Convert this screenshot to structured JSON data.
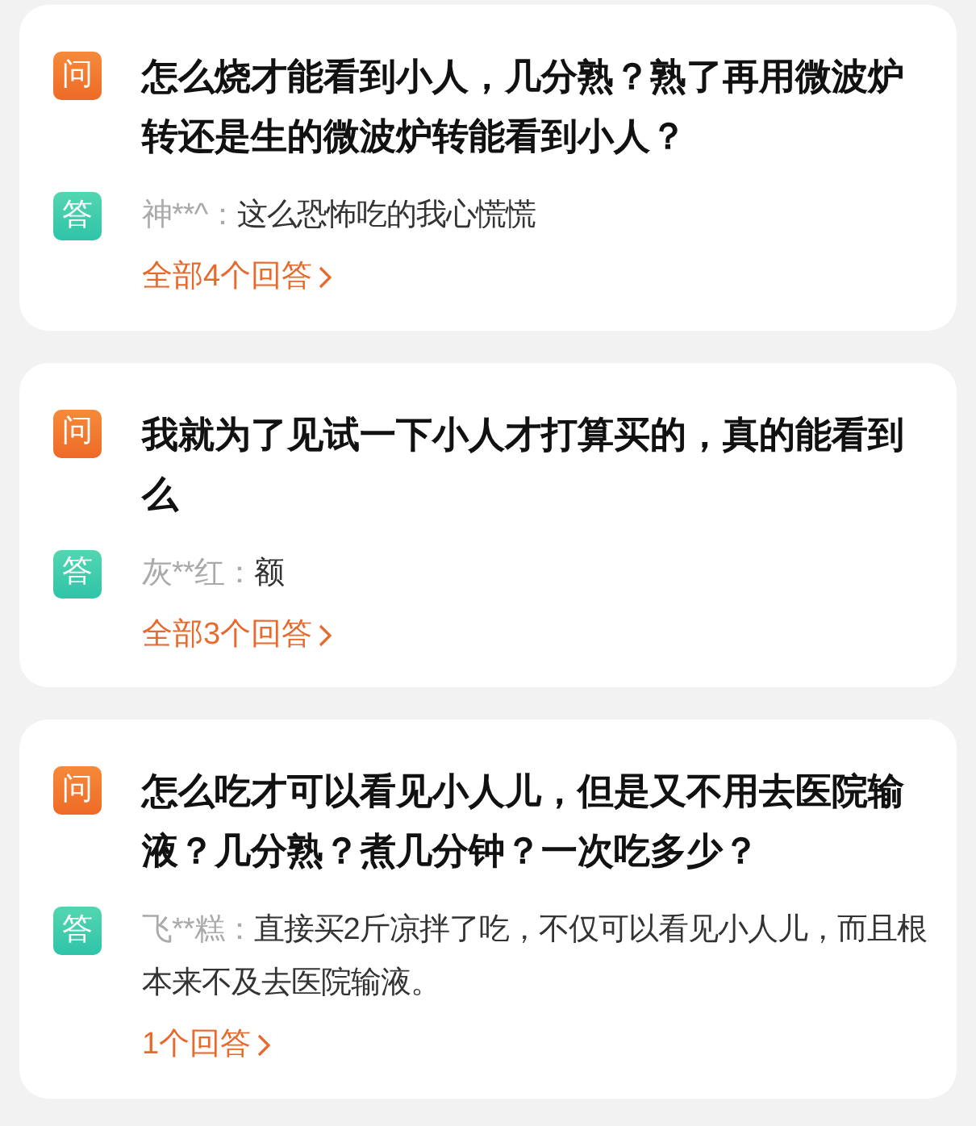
{
  "questions": [
    {
      "q_badge": "问",
      "question": "怎么烧才能看到小人，几分熟？熟了再用微波炉转还是生的微波炉转能看到小人？",
      "a_badge": "答",
      "user": "神**^：",
      "answer": "这么恐怖吃的我心慌慌",
      "more": "全部4个回答"
    },
    {
      "q_badge": "问",
      "question": "我就为了见试一下小人才打算买的，真的能看到么",
      "a_badge": "答",
      "user": "灰**红：",
      "answer": "额",
      "more": "全部3个回答"
    },
    {
      "q_badge": "问",
      "question": "怎么吃才可以看见小人儿，但是又不用去医院输液？几分熟？煮几分钟？一次吃多少？",
      "a_badge": "答",
      "user": "飞**糕：",
      "answer": "直接买2斤凉拌了吃，不仅可以看见小人儿，而且根本来不及去医院输液。",
      "more": "1个回答"
    }
  ]
}
